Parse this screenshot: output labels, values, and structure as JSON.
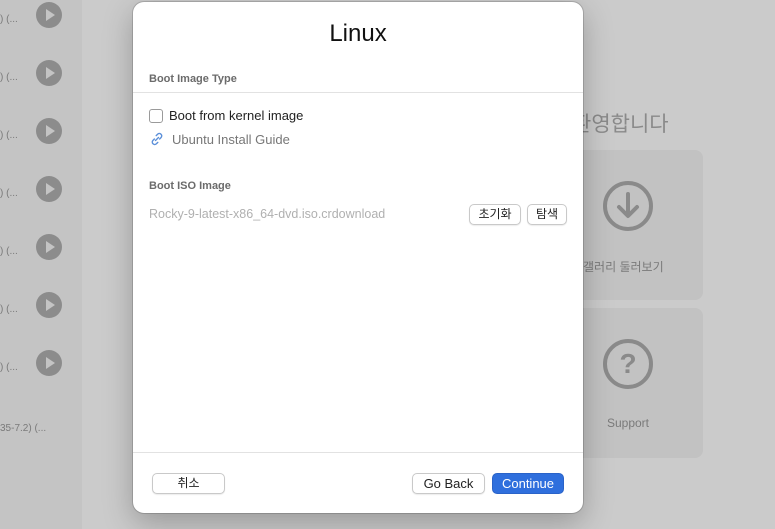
{
  "background": {
    "vm_rows": [
      {
        "subtitle": ") (..."
      },
      {
        "subtitle": ") (..."
      },
      {
        "subtitle": ") (..."
      },
      {
        "subtitle": ") (..."
      },
      {
        "subtitle": ") (..."
      },
      {
        "subtitle": ") (..."
      },
      {
        "subtitle": ") (..."
      }
    ],
    "last_row_subtitle": "35-7.2) (...",
    "welcome_text": "환영합니다",
    "tiles": [
      {
        "label": "TM 갤러리 둘러보기",
        "icon": "download-circle-icon"
      },
      {
        "label": "Support",
        "icon": "question-circle-icon"
      }
    ]
  },
  "dialog": {
    "title": "Linux",
    "boot_image_type": {
      "section_label": "Boot Image Type",
      "checkbox_label": "Boot from kernel image",
      "checkbox_checked": false,
      "link_label": "Ubuntu Install Guide"
    },
    "boot_iso": {
      "section_label": "Boot ISO Image",
      "path": "Rocky-9-latest-x86_64-dvd.iso.crdownload",
      "clear_label": "초기화",
      "browse_label": "탐색"
    },
    "footer": {
      "cancel_label": "취소",
      "back_label": "Go Back",
      "continue_label": "Continue"
    }
  },
  "colors": {
    "accent": "#2f6fdd",
    "overlay_bg": "#c9c9c9"
  }
}
